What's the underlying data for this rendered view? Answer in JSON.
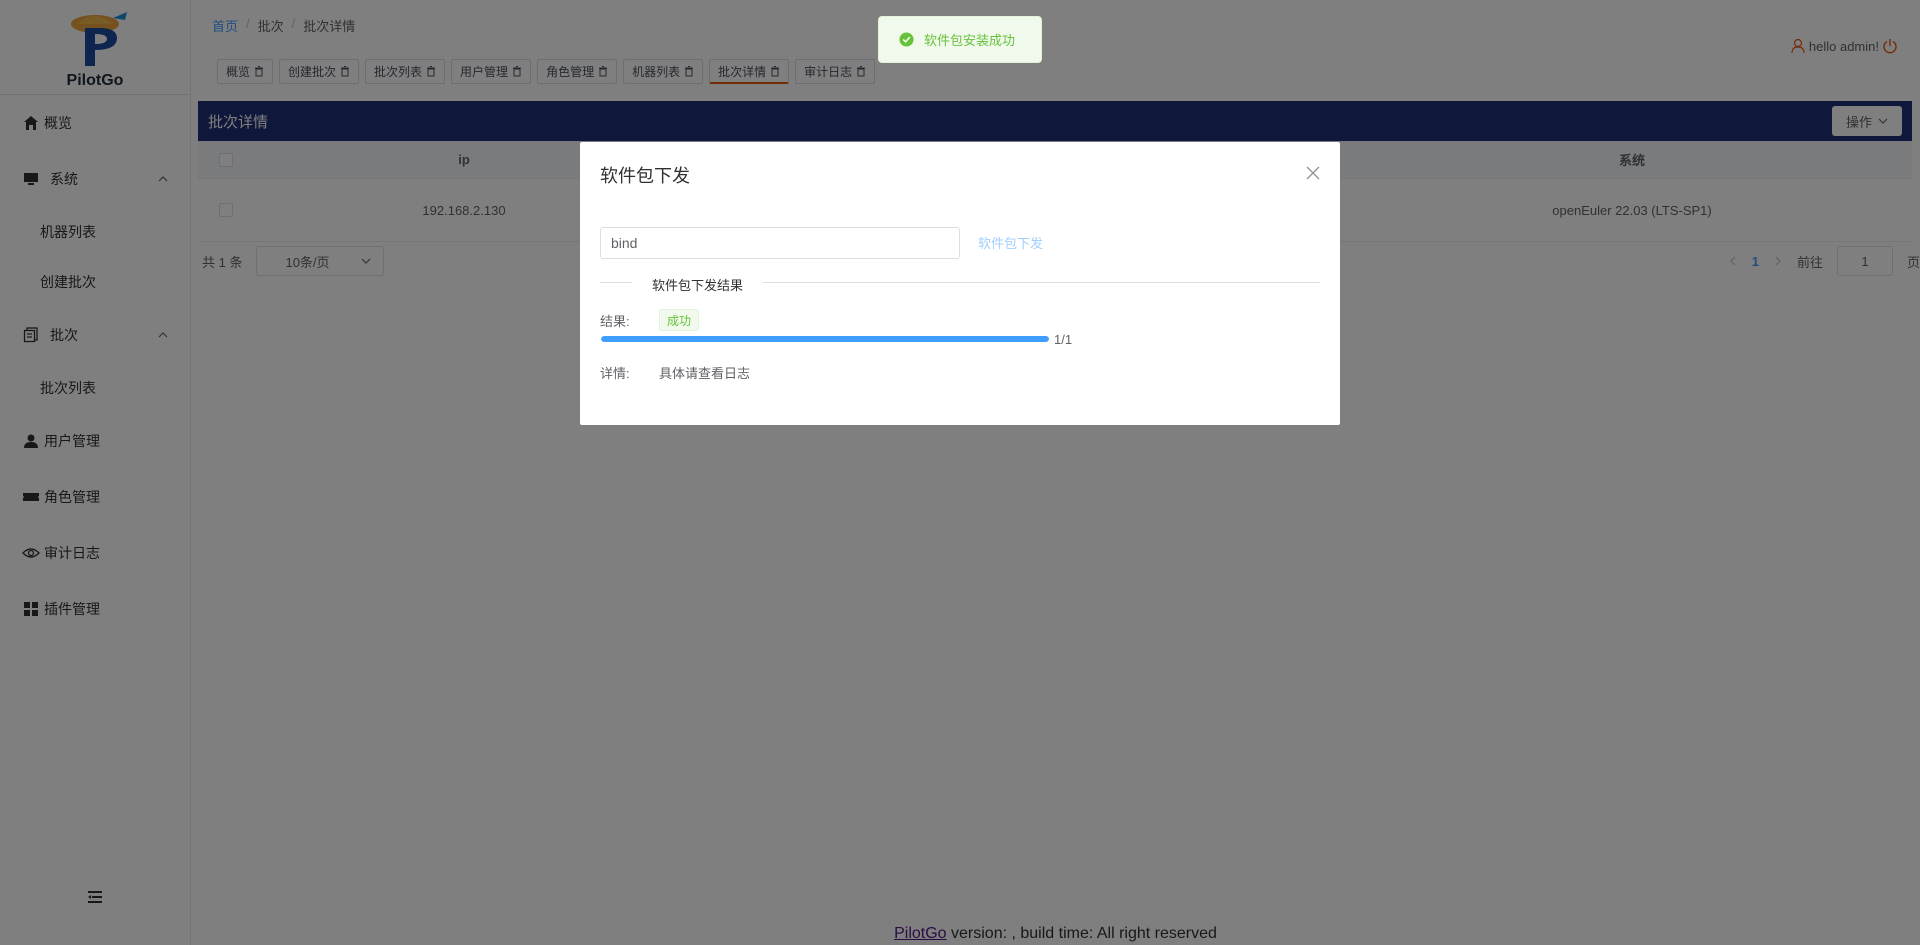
{
  "app": {
    "logo_text": "PilotGo"
  },
  "sidebar": {
    "items": [
      {
        "label": "概览",
        "icon": "home-icon"
      },
      {
        "label": "系统",
        "icon": "monitor-icon",
        "expanded": true
      },
      {
        "label": "机器列表"
      },
      {
        "label": "创建批次"
      },
      {
        "label": "批次",
        "icon": "batch-icon",
        "expanded": true
      },
      {
        "label": "批次列表"
      },
      {
        "label": "用户管理",
        "icon": "user-icon"
      },
      {
        "label": "角色管理",
        "icon": "ticket-icon"
      },
      {
        "label": "审计日志",
        "icon": "eye-icon"
      },
      {
        "label": "插件管理",
        "icon": "grid-icon"
      }
    ]
  },
  "breadcrumb": {
    "home": "首页",
    "sep": "/",
    "level1": "批次",
    "level2": "批次详情"
  },
  "user": {
    "greeting": "hello admin!"
  },
  "tags": [
    "概览",
    "创建批次",
    "批次列表",
    "用户管理",
    "角色管理",
    "机器列表",
    "批次详情",
    "审计日志"
  ],
  "panel": {
    "title": "批次详情",
    "action_label": "操作"
  },
  "table": {
    "headers": {
      "ip": "ip",
      "system": "系统"
    },
    "rows": [
      {
        "ip": "192.168.2.130",
        "system": "openEuler 22.03 (LTS-SP1)"
      }
    ]
  },
  "pagination": {
    "total": "共 1 条",
    "page_size": "10条/页",
    "current_page": "1",
    "goto_label": "前往",
    "goto_value": "1",
    "page_unit": "页"
  },
  "footer": {
    "link": "PilotGo",
    "text": " version: , build time: All right reserved"
  },
  "dialog": {
    "title": "软件包下发",
    "input_value": "bind",
    "button_label": "软件包下发",
    "section_label": "软件包下发结果",
    "result_label": "结果:",
    "result_value": "成功",
    "progress": 1.0,
    "progress_text": "1/1",
    "detail_label": "详情:",
    "detail_value": "具体请查看日志"
  },
  "toast": {
    "message": "软件包安装成功"
  },
  "colors": {
    "primary": "#409eff",
    "panel_header": "#1e2e77",
    "success": "#67c23a",
    "accent": "#e8590c"
  }
}
